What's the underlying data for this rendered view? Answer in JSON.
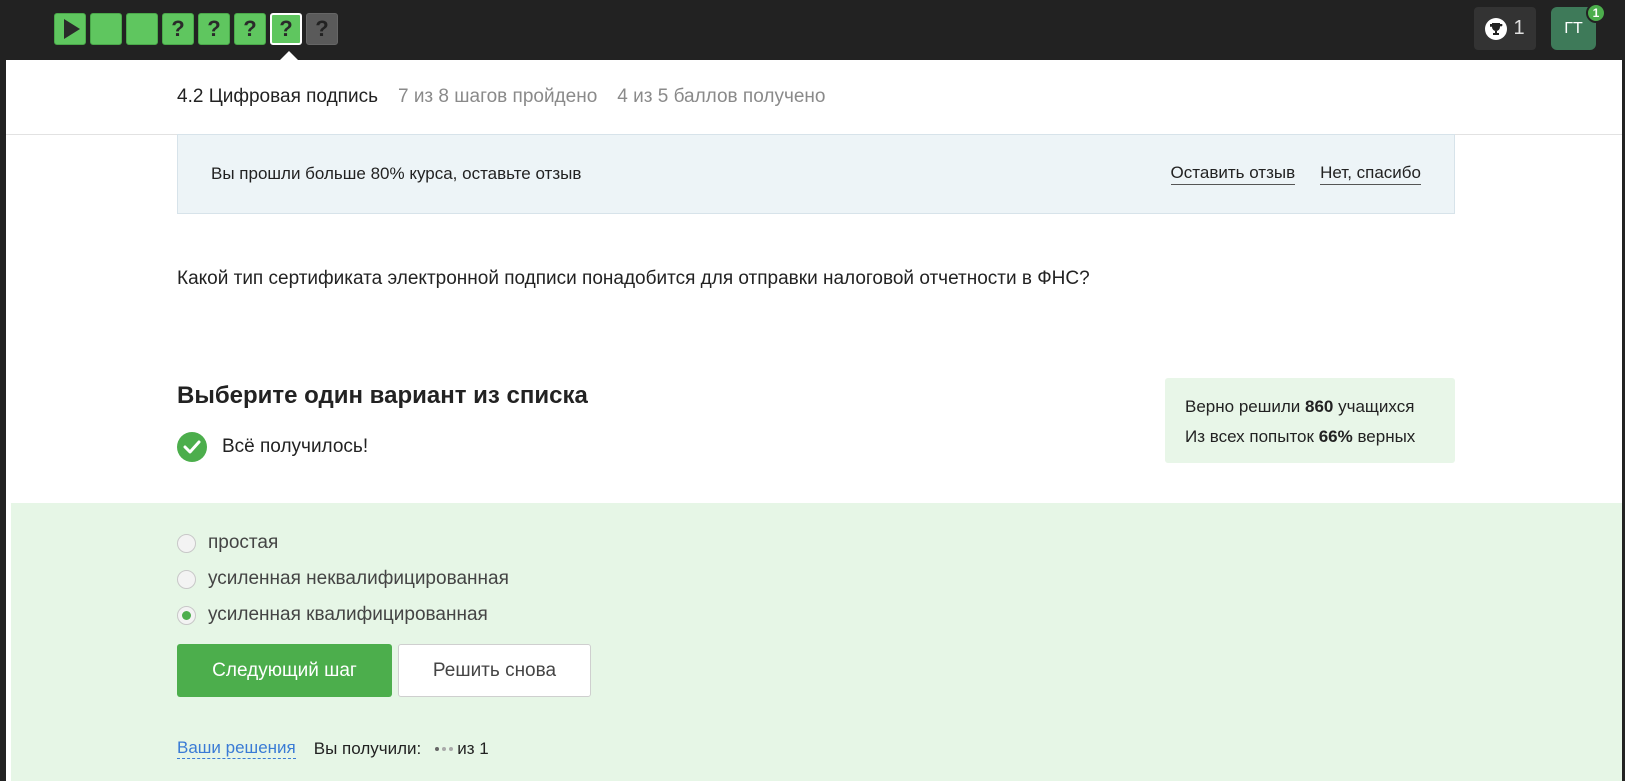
{
  "steps": [
    {
      "type": "video",
      "state": "done"
    },
    {
      "type": "text",
      "state": "done"
    },
    {
      "type": "text",
      "state": "done"
    },
    {
      "type": "quiz",
      "label": "?",
      "state": "done"
    },
    {
      "type": "quiz",
      "label": "?",
      "state": "done"
    },
    {
      "type": "quiz",
      "label": "?",
      "state": "done"
    },
    {
      "type": "quiz",
      "label": "?",
      "state": "current"
    },
    {
      "type": "quiz",
      "label": "?",
      "state": "pending"
    }
  ],
  "header": {
    "trophy_count": "1",
    "avatar_initials": "ГТ",
    "notification_count": "1"
  },
  "lesson": {
    "title": "4.2 Цифровая подпись",
    "progress": "7 из 8 шагов пройдено",
    "points": "4 из 5 баллов  получено"
  },
  "banner": {
    "text": "Вы прошли больше 80% курса, оставьте отзыв",
    "leave_review": "Оставить отзыв",
    "no_thanks": "Нет, спасибо"
  },
  "question": {
    "text": "Какой тип сертификата электронной подписи понадобится для отправки налоговой отчетности в ФНС?"
  },
  "quiz": {
    "instruction": "Выберите один вариант из списка",
    "result": "Всё получилось!",
    "options": [
      {
        "label": "простая",
        "checked": false
      },
      {
        "label": "усиленная неквалифицированная",
        "checked": false
      },
      {
        "label": "усиленная квалифицированная",
        "checked": true
      }
    ],
    "next_button": "Следующий шаг",
    "retry_button": "Решить снова"
  },
  "stats": {
    "solved_prefix": "Верно решили",
    "solved_count": "860",
    "solved_suffix": "учащихся",
    "attempts_prefix": "Из всех попыток",
    "attempts_percent": "66%",
    "attempts_suffix": "верных"
  },
  "footer": {
    "solutions_link": "Ваши решения",
    "you_got": "Вы получили:",
    "score_suffix": "из 1"
  },
  "colors": {
    "accent_green": "#4cae4c",
    "topbar": "#222222",
    "answer_bg": "#e6f6e6",
    "banner_bg": "#edf4f7",
    "link_blue": "#3a7bd5"
  }
}
